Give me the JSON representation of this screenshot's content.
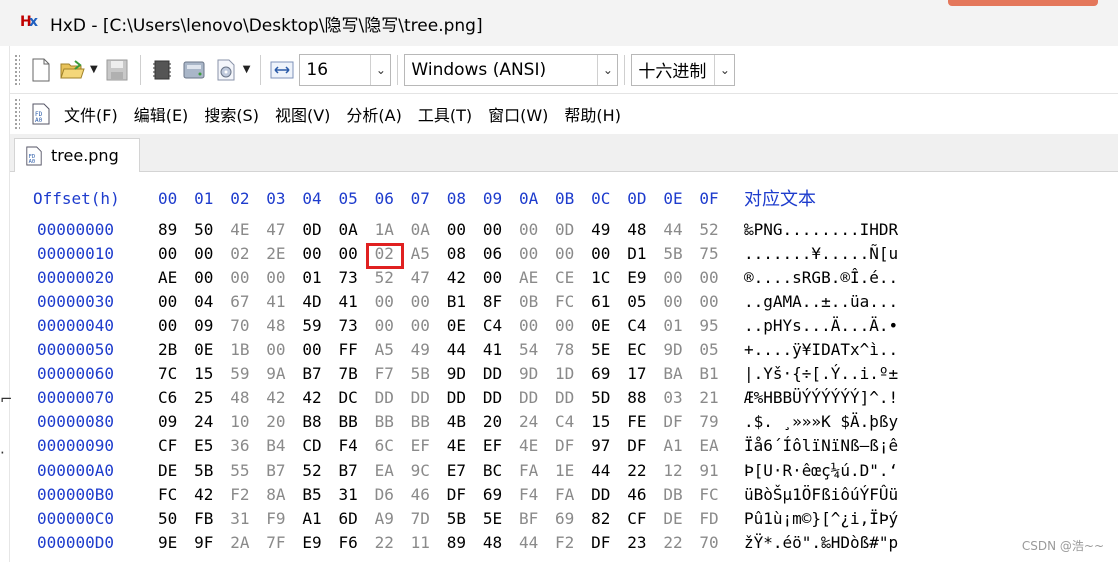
{
  "window": {
    "title": "HxD - [C:\\Users\\lenovo\\Desktop\\隐写\\隐写\\tree.png]"
  },
  "toolbar": {
    "bytes_per_row": "16",
    "charset": "Windows (ANSI)",
    "offset_base": "十六进制"
  },
  "menu": [
    {
      "label": "文件(F)"
    },
    {
      "label": "编辑(E)"
    },
    {
      "label": "搜索(S)"
    },
    {
      "label": "视图(V)"
    },
    {
      "label": "分析(A)"
    },
    {
      "label": "工具(T)"
    },
    {
      "label": "窗口(W)"
    },
    {
      "label": "帮助(H)"
    }
  ],
  "tab": {
    "label": "tree.png"
  },
  "hex": {
    "offset_header": "Offset(h)",
    "column_headers": [
      "00",
      "01",
      "02",
      "03",
      "04",
      "05",
      "06",
      "07",
      "08",
      "09",
      "0A",
      "0B",
      "0C",
      "0D",
      "0E",
      "0F"
    ],
    "text_header": "对应文本",
    "rows": [
      {
        "offset": "00000000",
        "bytes": [
          "89",
          "50",
          "4E",
          "47",
          "0D",
          "0A",
          "1A",
          "0A",
          "00",
          "00",
          "00",
          "0D",
          "49",
          "48",
          "44",
          "52"
        ],
        "text": "‰PNG........IHDR"
      },
      {
        "offset": "00000010",
        "bytes": [
          "00",
          "00",
          "02",
          "2E",
          "00",
          "00",
          "02",
          "A5",
          "08",
          "06",
          "00",
          "00",
          "00",
          "D1",
          "5B",
          "75"
        ],
        "text": ".......¥.....Ñ[u"
      },
      {
        "offset": "00000020",
        "bytes": [
          "AE",
          "00",
          "00",
          "00",
          "01",
          "73",
          "52",
          "47",
          "42",
          "00",
          "AE",
          "CE",
          "1C",
          "E9",
          "00",
          "00"
        ],
        "text": "®....sRGB.®Î.é.."
      },
      {
        "offset": "00000030",
        "bytes": [
          "00",
          "04",
          "67",
          "41",
          "4D",
          "41",
          "00",
          "00",
          "B1",
          "8F",
          "0B",
          "FC",
          "61",
          "05",
          "00",
          "00"
        ],
        "text": "..gAMA..±..üa..."
      },
      {
        "offset": "00000040",
        "bytes": [
          "00",
          "09",
          "70",
          "48",
          "59",
          "73",
          "00",
          "00",
          "0E",
          "C4",
          "00",
          "00",
          "0E",
          "C4",
          "01",
          "95"
        ],
        "text": "..pHYs...Ä...Ä.•"
      },
      {
        "offset": "00000050",
        "bytes": [
          "2B",
          "0E",
          "1B",
          "00",
          "00",
          "FF",
          "A5",
          "49",
          "44",
          "41",
          "54",
          "78",
          "5E",
          "EC",
          "9D",
          "05"
        ],
        "text": "+....ÿ¥IDATx^ì.."
      },
      {
        "offset": "00000060",
        "bytes": [
          "7C",
          "15",
          "59",
          "9A",
          "B7",
          "7B",
          "F7",
          "5B",
          "9D",
          "DD",
          "9D",
          "1D",
          "69",
          "17",
          "BA",
          "B1"
        ],
        "text": "|.Yš·{÷[.Ý..i.º±"
      },
      {
        "offset": "00000070",
        "bytes": [
          "C6",
          "25",
          "48",
          "42",
          "42",
          "DC",
          "DD",
          "DD",
          "DD",
          "DD",
          "DD",
          "DD",
          "5D",
          "88",
          "03",
          "21"
        ],
        "text": "Æ%HBBÜÝÝÝÝÝÝ]^.!"
      },
      {
        "offset": "00000080",
        "bytes": [
          "09",
          "24",
          "10",
          "20",
          "B8",
          "BB",
          "BB",
          "BB",
          "4B",
          "20",
          "24",
          "C4",
          "15",
          "FE",
          "DF",
          "79"
        ],
        "text": ".$. ¸»»»K $Ä.þßy"
      },
      {
        "offset": "00000090",
        "bytes": [
          "CF",
          "E5",
          "36",
          "B4",
          "CD",
          "F4",
          "6C",
          "EF",
          "4E",
          "EF",
          "4E",
          "DF",
          "97",
          "DF",
          "A1",
          "EA"
        ],
        "text": "Ïå6´ÍôlïNïNß—ß¡ê"
      },
      {
        "offset": "000000A0",
        "bytes": [
          "DE",
          "5B",
          "55",
          "B7",
          "52",
          "B7",
          "EA",
          "9C",
          "E7",
          "BC",
          "FA",
          "1E",
          "44",
          "22",
          "12",
          "91"
        ],
        "text": "Þ[U·R·êœç¼ú.D\".‘"
      },
      {
        "offset": "000000B0",
        "bytes": [
          "FC",
          "42",
          "F2",
          "8A",
          "B5",
          "31",
          "D6",
          "46",
          "DF",
          "69",
          "F4",
          "FA",
          "DD",
          "46",
          "DB",
          "FC"
        ],
        "text": "üBòŠµ1ÖFßiôúÝFÛü"
      },
      {
        "offset": "000000C0",
        "bytes": [
          "50",
          "FB",
          "31",
          "F9",
          "A1",
          "6D",
          "A9",
          "7D",
          "5B",
          "5E",
          "BF",
          "69",
          "82",
          "CF",
          "DE",
          "FD"
        ],
        "text": "Pû1ù¡m©}[^¿i‚ÏÞý"
      },
      {
        "offset": "000000D0",
        "bytes": [
          "9E",
          "9F",
          "2A",
          "7F",
          "E9",
          "F6",
          "22",
          "11",
          "89",
          "48",
          "44",
          "F2",
          "DF",
          "23",
          "22",
          "70"
        ],
        "text": "žŸ*.éö\".‰HDòß#\"p"
      }
    ]
  },
  "watermark": "CSDN @浩~~"
}
